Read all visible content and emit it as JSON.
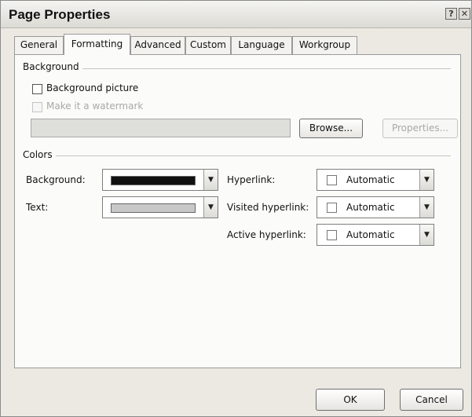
{
  "window": {
    "title": "Page Properties",
    "help_glyph": "?",
    "close_glyph": "✕"
  },
  "tabs": [
    "General",
    "Formatting",
    "Advanced",
    "Custom",
    "Language",
    "Workgroup"
  ],
  "active_tab": "Formatting",
  "background_section": {
    "title": "Background",
    "background_picture_label": "Background picture",
    "background_picture_checked": false,
    "watermark_label": "Make it a watermark",
    "watermark_enabled": false,
    "picture_path_value": "",
    "browse_label": "Browse...",
    "properties_label": "Properties..."
  },
  "colors_section": {
    "title": "Colors",
    "background_label": "Background:",
    "background_color": "#111111",
    "text_label": "Text:",
    "text_color": "#c8c8c8",
    "hyperlink_label": "Hyperlink:",
    "hyperlink_value": "Automatic",
    "visited_label": "Visited hyperlink:",
    "visited_value": "Automatic",
    "active_label": "Active hyperlink:",
    "active_value": "Automatic"
  },
  "footer": {
    "ok_label": "OK",
    "cancel_label": "Cancel"
  },
  "icons": {
    "dropdown": "chevron-down-icon"
  }
}
